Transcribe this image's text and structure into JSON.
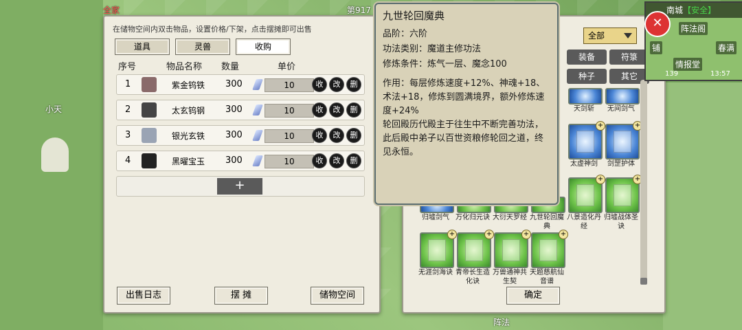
{
  "background": {
    "floor_label": "第917",
    "npc_name": "全家",
    "player_tag": "小天",
    "bottom_label": "阵法"
  },
  "left_panel": {
    "hint": "在储物空间内双击物品，设置价格/下架，点击摆摊即可出售",
    "tabs": [
      {
        "label": "道具",
        "active": false
      },
      {
        "label": "灵兽",
        "active": false
      },
      {
        "label": "收购",
        "active": true
      }
    ],
    "headers": {
      "index": "序号",
      "name": "物品名称",
      "qty": "数量",
      "price": "单价"
    },
    "rows": [
      {
        "index": "1",
        "name": "紫金钨铁",
        "qty": "300",
        "price": "10",
        "icon_color": "#8a6a6a"
      },
      {
        "index": "2",
        "name": "太玄钨钢",
        "qty": "300",
        "price": "10",
        "icon_color": "#444444"
      },
      {
        "index": "3",
        "name": "银光玄铁",
        "qty": "300",
        "price": "10",
        "icon_color": "#9aa4b4"
      },
      {
        "index": "4",
        "name": "黑曜宝玉",
        "qty": "300",
        "price": "10",
        "icon_color": "#222222"
      }
    ],
    "row_actions": [
      "收",
      "改",
      "删"
    ],
    "add_label": "+",
    "buttons": {
      "log": "出售日志",
      "stall": "摆 摊",
      "storage": "储物空间"
    }
  },
  "tooltip": {
    "title": "九世轮回魔典",
    "grade": "品阶：六阶",
    "category": "功法类别：魔道主修功法",
    "requirement": "修炼条件：炼气一层、魔念100",
    "effect": "作用：每层修炼速度+12%、神魂+18、术法+18，修炼到圆满境界，额外修炼速度+24%",
    "story": "轮回殿历代殿主于往生中不断完善功法，此后殿中弟子以百世资粮修轮回之道，终见永恒。"
  },
  "right_panel": {
    "filter": "全部",
    "categories": [
      "装备",
      "符箓",
      "种子",
      "其它"
    ],
    "cards": [
      {
        "name": "天剑斩",
        "color": "blue"
      },
      {
        "name": "无间剑气",
        "color": "blue"
      },
      {
        "name": "太虚神剑",
        "color": "blue"
      },
      {
        "name": "剑罡护体",
        "color": "blue"
      },
      {
        "name": "归墟剑气",
        "color": "blue"
      },
      {
        "name": "万化归元诀",
        "color": "green"
      },
      {
        "name": "大衍天罗经",
        "color": "green"
      },
      {
        "name": "九世轮回魔典",
        "color": "green"
      },
      {
        "name": "八景造化丹经",
        "color": "green"
      },
      {
        "name": "归墟战体圣诀",
        "color": "green"
      },
      {
        "name": "无涯剑海诀",
        "color": "green"
      },
      {
        "name": "青帝长生造化诀",
        "color": "green"
      },
      {
        "name": "万兽通神共生契",
        "color": "green"
      },
      {
        "name": "天题慈航仙音谱",
        "color": "green"
      }
    ],
    "confirm": "确定"
  },
  "minimap": {
    "city": "南城",
    "safe": "【安全】",
    "labels": [
      "阵法阁",
      "铺",
      "春满",
      "情报堂"
    ],
    "time_left": "139",
    "time_right": "13:57"
  },
  "colors": {
    "panel_bg": "#efece0",
    "tooltip_bg": "#d9d2b8",
    "filter_bg": "#e9d48a"
  }
}
